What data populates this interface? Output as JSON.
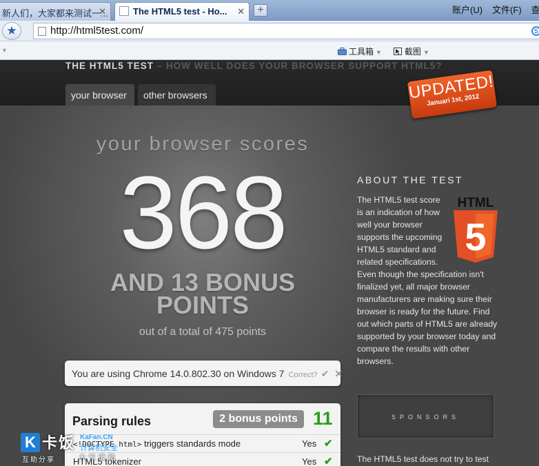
{
  "browser": {
    "tabs": [
      {
        "label": "新人们，大家都来测试一...",
        "active": false
      },
      {
        "label": "The HTML5 test - Ho...",
        "active": true
      }
    ],
    "new_tab_symbol": "+",
    "close_symbol": "✕",
    "menu": [
      "账户(U)",
      "文件(F)",
      "查看"
    ],
    "url": "http://html5test.com/",
    "toolbar": {
      "tools_label": "工具箱",
      "screenshot_label": "截图"
    },
    "icons": [
      "star-icon",
      "page-icon",
      "search-engine-icon",
      "toolbox-icon",
      "screenshot-icon"
    ]
  },
  "site": {
    "title_main": "THE HTML5 TEST",
    "title_sub": " – HOW WELL DOES YOUR BROWSER SUPPORT HTML5?",
    "nav": [
      {
        "label": "your browser",
        "active": true
      },
      {
        "label": "other browsers",
        "active": false
      }
    ],
    "badge": {
      "headline": "UPDATED!",
      "date": "Januari 1st, 2012"
    }
  },
  "score": {
    "heading": "your browser scores",
    "value": "368",
    "bonus_line1": "AND 13 BONUS",
    "bonus_line2": "POINTS",
    "total_text": "out of a total of 475 points"
  },
  "detection": {
    "text": "You are using Chrome 14.0.802.30 on Windows 7",
    "correct_label": "Correct?",
    "check_symbol": "✔",
    "cross_symbol": "✕"
  },
  "parsing": {
    "title": "Parsing rules",
    "bonus_pill": "2 bonus points",
    "score": "11",
    "rows": [
      {
        "code": "<!DOCTYPE html>",
        "text": " triggers standards mode",
        "result": "Yes",
        "mark": "✔"
      },
      {
        "code": "",
        "text": "HTML5 tokenizer",
        "result": "Yes",
        "mark": "✔"
      }
    ]
  },
  "about": {
    "heading": "ABOUT THE TEST",
    "body": "The HTML5 test score is an indication of how well your browser supports the upcoming HTML5 standard and related specifications. Even though the specification isn't finalized yet, all major browser manufacturers are making sure their browser is ready for the future. Find out which parts of HTML5 are already supported by your browser today and compare the results with other browsers.",
    "logo_text": "HTML",
    "logo_number": "5",
    "sponsors_label": "SPONSORS",
    "footer_note": "The HTML5 test does not try to test"
  },
  "watermark": {
    "k": "K",
    "big": "卡饭",
    "site": "KaFan.CN",
    "cn": "计算机安全",
    "sub1": "互助分享",
    "sub2": "大气谦和"
  },
  "colors": {
    "accent_orange": "#e0501c",
    "pass_green": "#2a9b1e",
    "page_bg": "#474747"
  }
}
